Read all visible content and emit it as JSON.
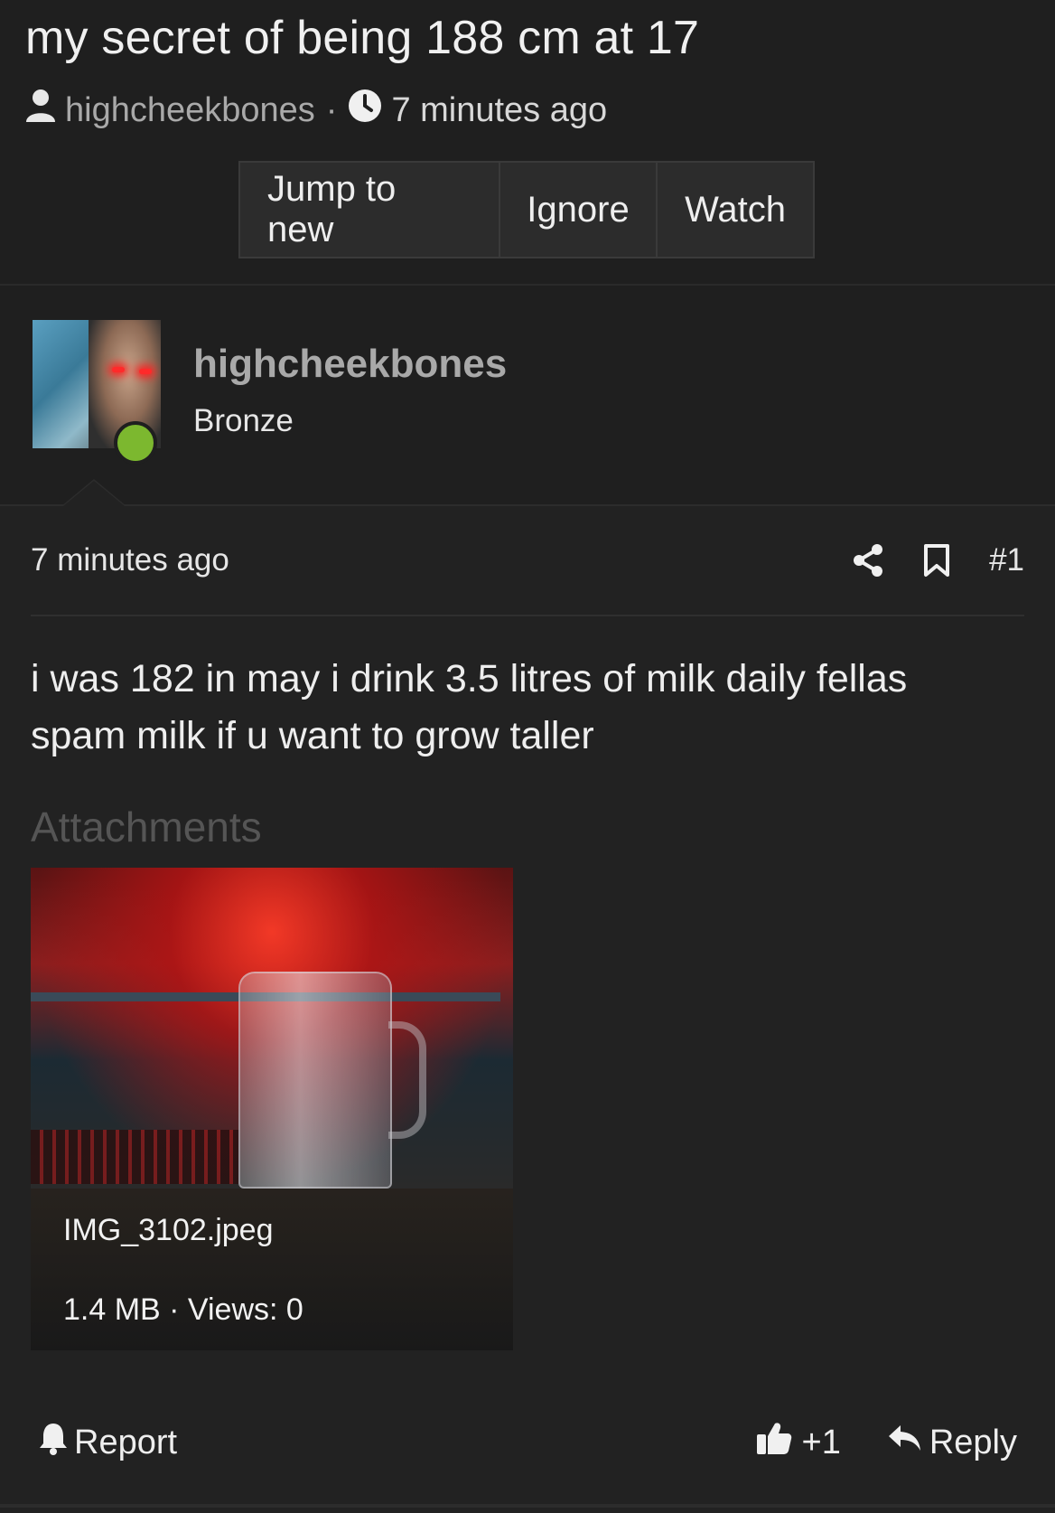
{
  "thread": {
    "title": "my secret of being 188 cm at 17",
    "author": "highcheekbones",
    "separator": "·",
    "time": "7 minutes ago"
  },
  "toolbar": {
    "jump_label": "Jump to new",
    "ignore_label": "Ignore",
    "watch_label": "Watch"
  },
  "user": {
    "name": "highcheekbones",
    "rank": "Bronze",
    "online": true
  },
  "post": {
    "time": "7 minutes ago",
    "number": "#1",
    "body_line1": "i was 182 in may i drink 3.5 litres of milk daily fellas",
    "body_line2": "spam milk if u want to grow taller",
    "attachments_title": "Attachments",
    "attachment": {
      "file_name": "IMG_3102.jpeg",
      "file_info": "1.4 MB · Views: 0"
    }
  },
  "footer": {
    "report_label": "Report",
    "reaction_label": "+1",
    "reply_label": "Reply"
  },
  "colors": {
    "background": "#222222",
    "header_bg": "#1f1f1f",
    "online_dot": "#7cb82f",
    "muted_text": "#a9a9a9"
  },
  "icons": [
    "user-icon",
    "clock-icon",
    "share-icon",
    "bookmark-icon",
    "bell-icon",
    "thumbs-up-icon",
    "reply-icon"
  ]
}
